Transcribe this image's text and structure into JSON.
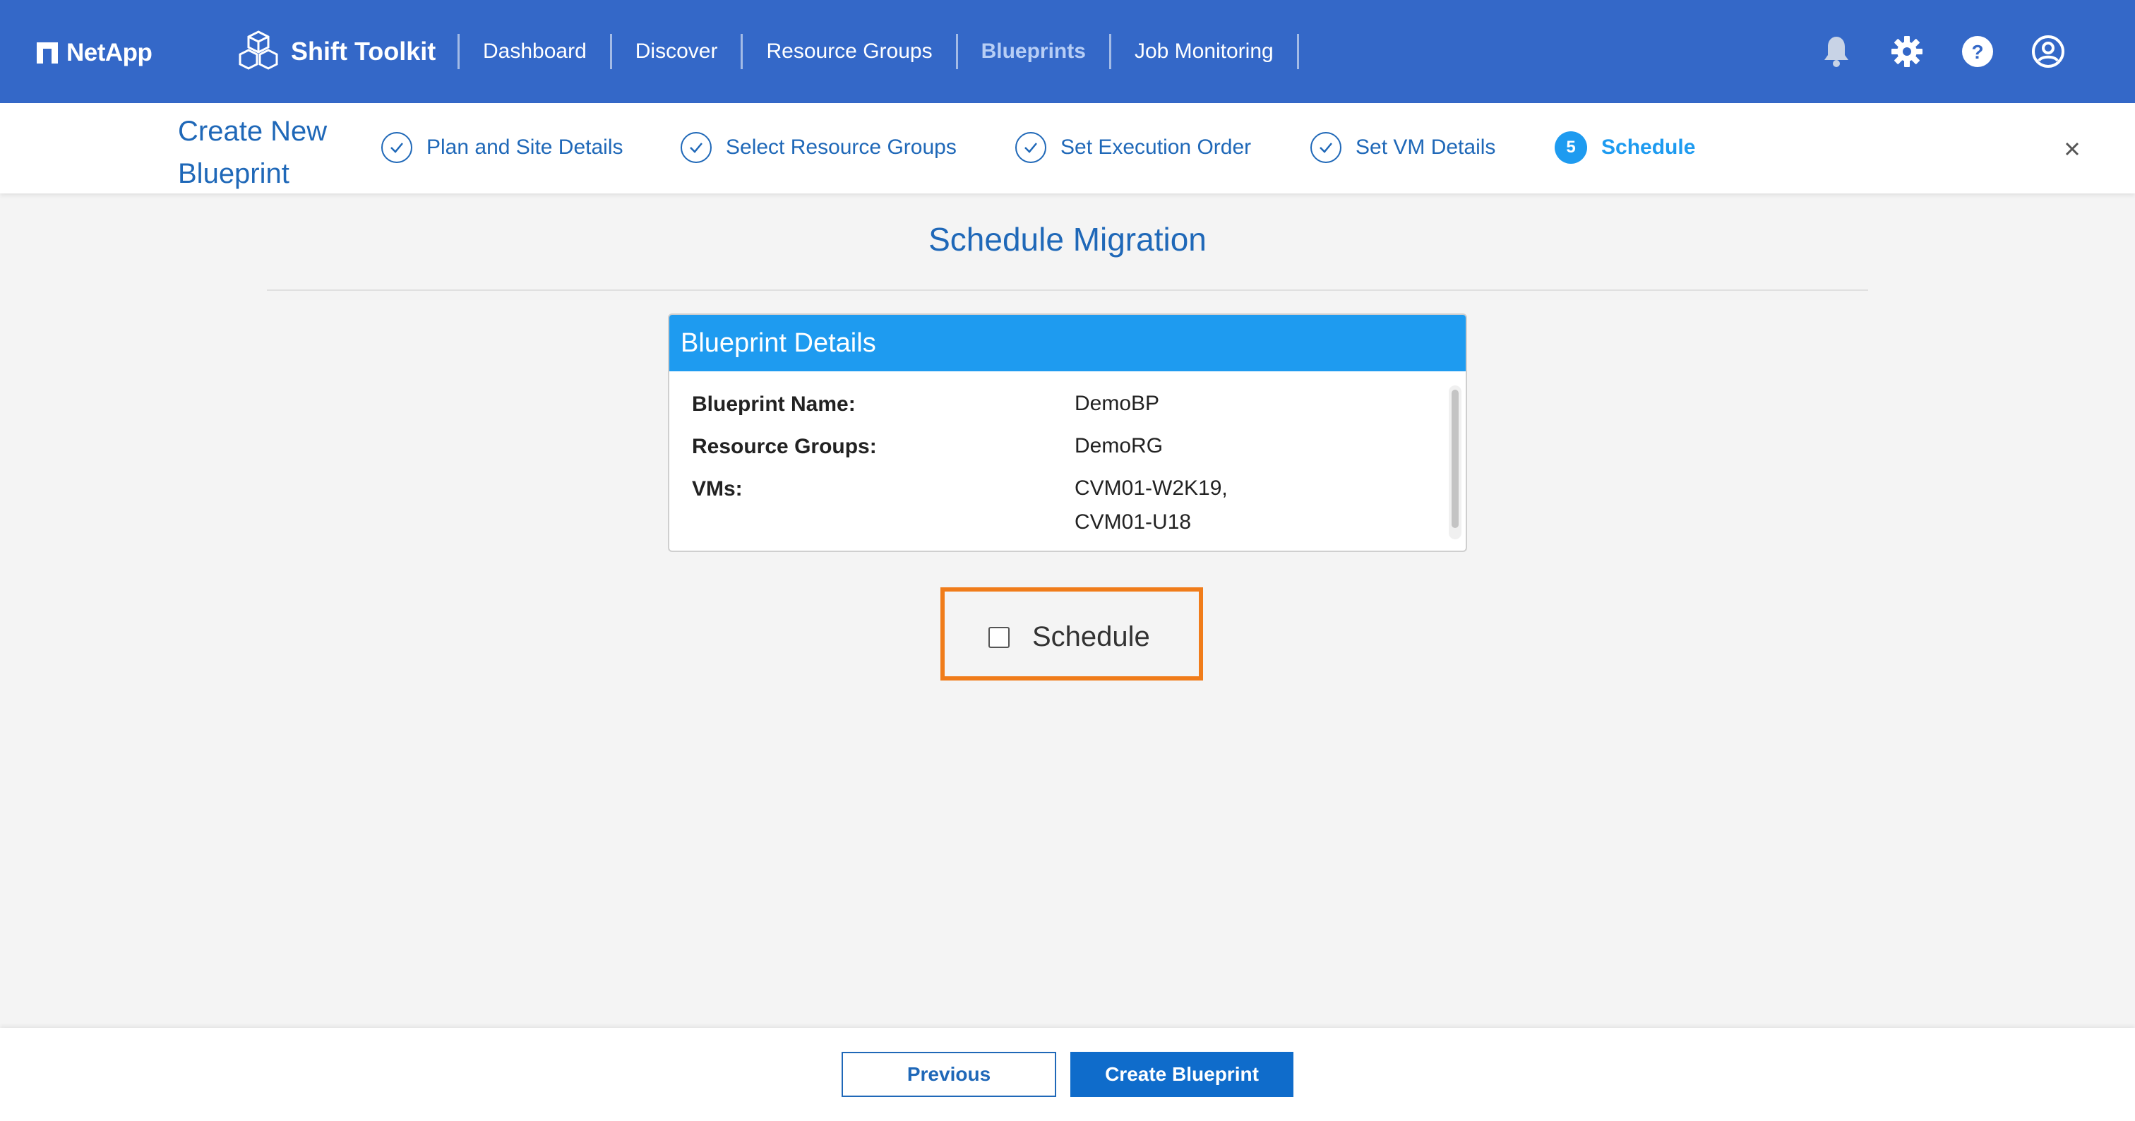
{
  "brand": {
    "name": "NetApp"
  },
  "product": {
    "name": "Shift Toolkit"
  },
  "nav": {
    "items": [
      {
        "label": "Dashboard"
      },
      {
        "label": "Discover"
      },
      {
        "label": "Resource Groups"
      },
      {
        "label": "Blueprints",
        "active": true
      },
      {
        "label": "Job Monitoring"
      }
    ]
  },
  "header_icons": [
    "bell-icon",
    "gear-icon",
    "help-icon",
    "user-icon"
  ],
  "wizard": {
    "title": "Create New Blueprint",
    "steps": [
      {
        "label": "Plan and Site Details",
        "state": "done"
      },
      {
        "label": "Select Resource Groups",
        "state": "done"
      },
      {
        "label": "Set Execution Order",
        "state": "done"
      },
      {
        "label": "Set VM Details",
        "state": "done"
      },
      {
        "label": "Schedule",
        "number": "5",
        "state": "current"
      }
    ]
  },
  "main": {
    "heading": "Schedule Migration",
    "card": {
      "title": "Blueprint Details",
      "rows": [
        {
          "key": "Blueprint Name:",
          "value": "DemoBP"
        },
        {
          "key": "Resource Groups:",
          "value": "DemoRG"
        },
        {
          "key": "VMs:",
          "value": "CVM01-W2K19,",
          "value2": "CVM01-U18"
        }
      ]
    },
    "schedule_checkbox": {
      "label": "Schedule",
      "checked": false
    }
  },
  "footer": {
    "previous_label": "Previous",
    "create_label": "Create Blueprint"
  },
  "colors": {
    "nav_bg": "#3468c8",
    "primary": "#1f68b8",
    "accent": "#1e9bf0",
    "highlight": "#f07c1a"
  }
}
